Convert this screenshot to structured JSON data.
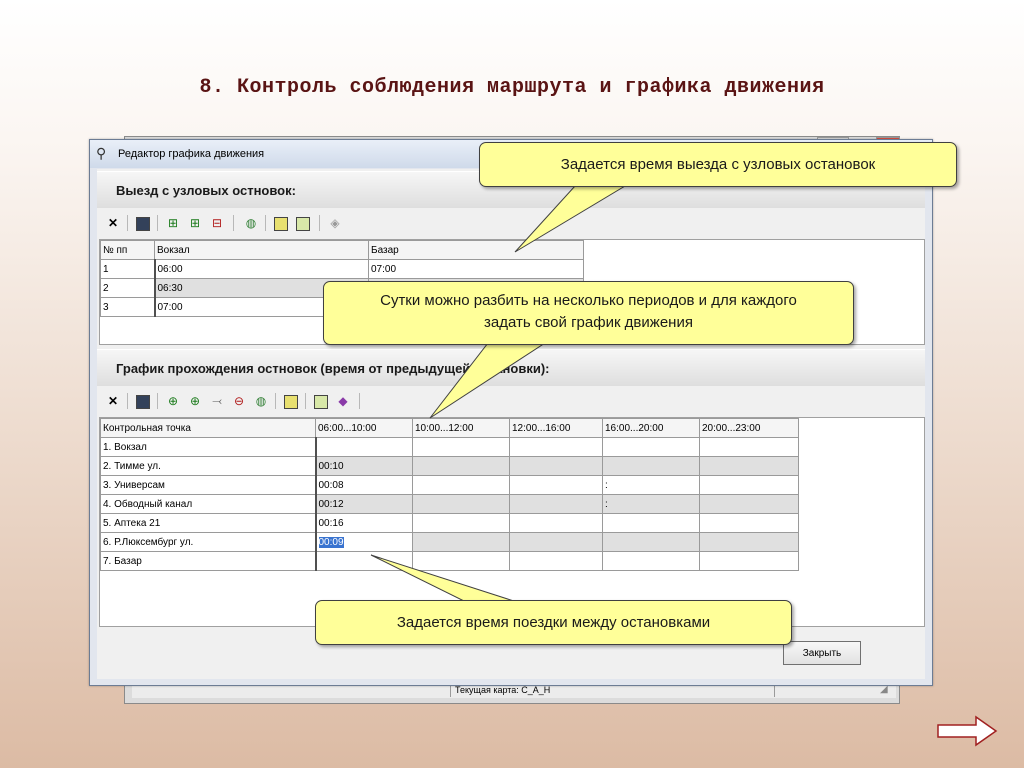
{
  "slide": {
    "title": "8. Контроль соблюдения маршрута и графика движения"
  },
  "background_window": {
    "status_text": "Текущая карта: C_A_H"
  },
  "window": {
    "title": "Редактор графика движения",
    "close_label": "Закрыть"
  },
  "departures": {
    "header": "Выезд с узловых остновок:",
    "columns": [
      "№ пп",
      "Вокзал",
      "Базар"
    ],
    "rows": [
      {
        "n": "1",
        "vokzal": "06:00",
        "bazar": "07:00"
      },
      {
        "n": "2",
        "vokzal": "06:30",
        "bazar": ""
      },
      {
        "n": "3",
        "vokzal": "07:00",
        "bazar": ""
      }
    ]
  },
  "passage": {
    "header": "График прохождения остновок (время от предыдущей остановки):",
    "columns": [
      "Контрольная точка",
      "06:00...10:00",
      "10:00...12:00",
      "12:00...16:00",
      "16:00...20:00",
      "20:00...23:00"
    ],
    "rows": [
      {
        "point": "1. Вокзал",
        "p1": "",
        "p4": ""
      },
      {
        "point": "2. Тимме ул.",
        "p1": "00:10",
        "p4": ""
      },
      {
        "point": "3. Универсам",
        "p1": "00:08",
        "p4": ":"
      },
      {
        "point": "4. Обводный канал",
        "p1": "00:12",
        "p4": ":"
      },
      {
        "point": "5. Аптека 21",
        "p1": "00:16",
        "p4": ""
      },
      {
        "point": "6. Р.Люксембург ул.",
        "p1": "00:09",
        "p4": ""
      },
      {
        "point": "7. Базар",
        "p1": "",
        "p4": ""
      }
    ]
  },
  "callouts": {
    "departure": "Задается время выезда с узловых остановок",
    "periods": "Сутки можно разбить на несколько периодов и для каждого задать свой график движения",
    "travel": "Задается время поездки между остановками"
  },
  "colors": {
    "callout_fill": "#ffff99",
    "title_color": "#5a1414",
    "selection": "#3a74d0"
  }
}
